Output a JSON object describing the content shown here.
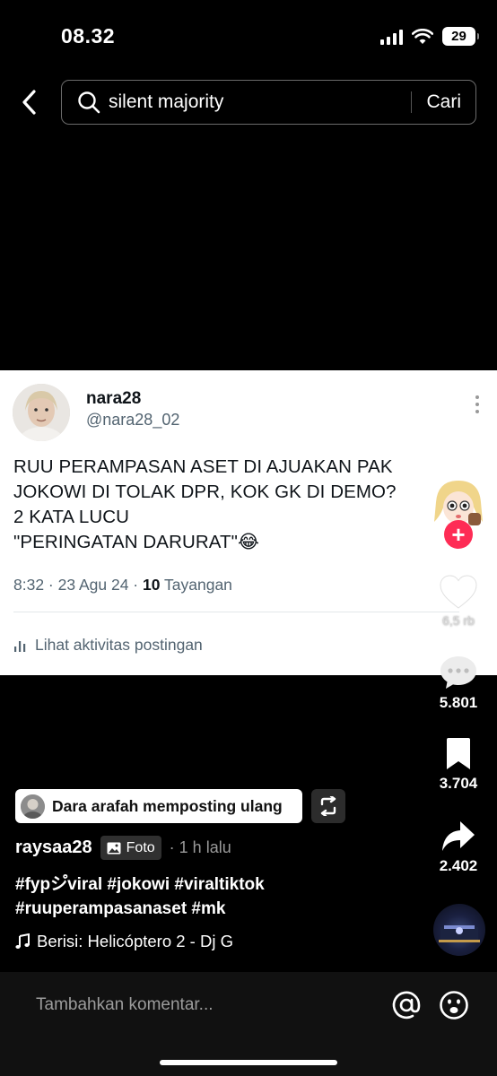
{
  "status_bar": {
    "time": "08.32",
    "battery": "29"
  },
  "search": {
    "query": "silent majority",
    "submit_label": "Cari"
  },
  "post_card": {
    "display_name": "nara28",
    "handle": "@nara28_02",
    "text_lines": [
      "RUU PERAMPASAN ASET DI AJUAKAN PAK",
      "JOKOWI DI TOLAK DPR, KOK GK DI DEMO?",
      "2 KATA LUCU",
      "\"PERINGATAN DARURAT\"😂"
    ],
    "meta_prefix": "8:32 · 23 Agu 24 · ",
    "views_count": "10",
    "views_label": " Tayangan",
    "activity_label": "Lihat aktivitas postingan"
  },
  "actions": {
    "likes": "6,5 rb",
    "comments": "5.801",
    "saves": "3.704",
    "shares": "2.402"
  },
  "repost": {
    "text": "Dara arafah memposting ulang"
  },
  "author": {
    "username": "raysaa28",
    "badge": "Foto",
    "time": "· 1 h lalu"
  },
  "caption": {
    "line1": "#fypシ゚viral #jokowi #viraltiktok",
    "line2": "#ruuperampasanaset #mk"
  },
  "music": {
    "label": "Berisi: Helicóptero 2 - Dj G"
  },
  "comment_bar": {
    "placeholder": "Tambahkan komentar..."
  },
  "icons": [
    "back-arrow-icon",
    "search-icon",
    "more-icon",
    "like-icon",
    "comment-icon",
    "bookmark-icon",
    "share-icon",
    "repost-icon",
    "photo-icon",
    "music-note-icon",
    "at-icon",
    "emoji-icon",
    "signal-icon",
    "wifi-icon",
    "battery-icon"
  ],
  "colors": {
    "accent_follow": "#fe2c55",
    "background": "#000000",
    "card": "#ffffff",
    "muted_text": "#536471"
  }
}
